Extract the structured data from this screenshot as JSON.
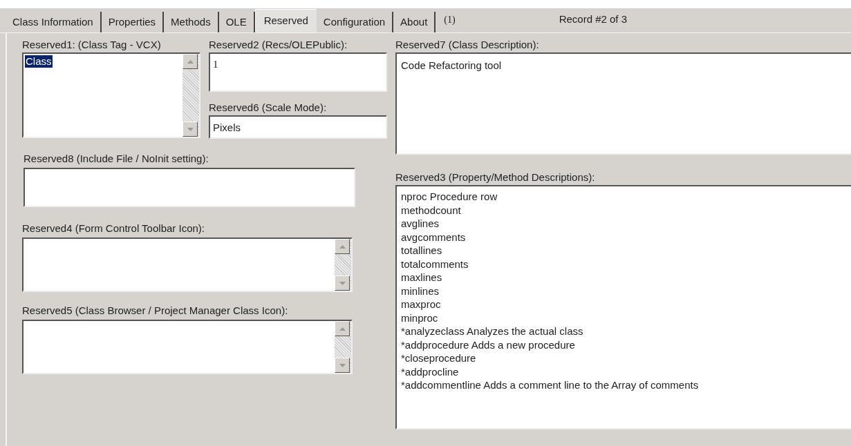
{
  "tabs": [
    {
      "label": "Class Information",
      "selected": false
    },
    {
      "label": "Properties",
      "selected": false
    },
    {
      "label": "Methods",
      "selected": false
    },
    {
      "label": "OLE",
      "selected": false
    },
    {
      "label": "Reserved",
      "selected": true
    },
    {
      "label": "Configuration",
      "selected": false
    },
    {
      "label": "About",
      "selected": false
    }
  ],
  "tab_note": "(1)",
  "record_indicator": "Record #2 of 3",
  "reserved1": {
    "label": "Reserved1: (Class Tag - VCX)",
    "items": [
      {
        "text": "Class",
        "selected": true
      }
    ]
  },
  "reserved2": {
    "label": "Reserved2 (Recs/OLEPublic):",
    "value": "1"
  },
  "reserved6": {
    "label": "Reserved6 (Scale Mode):",
    "value": "Pixels"
  },
  "reserved7": {
    "label": "Reserved7 (Class Description):",
    "value": "Code Refactoring tool"
  },
  "reserved8": {
    "label": "Reserved8 (Include File / NoInit setting):"
  },
  "reserved4": {
    "label": "Reserved4 (Form Control Toolbar Icon):"
  },
  "reserved5": {
    "label": "Reserved5 (Class Browser / Project Manager Class Icon):"
  },
  "reserved3": {
    "label": "Reserved3 (Property/Method Descriptions):",
    "lines": [
      "nproc Procedure row",
      "methodcount",
      "avglines",
      "avgcomments",
      "totallines",
      "totalcomments",
      "maxlines",
      "minlines",
      "maxproc",
      "minproc",
      "*analyzeclass Analyzes the actual class",
      "*addprocedure Adds a new procedure",
      "*closeprocedure",
      "*addprocline",
      "*addcommentline Adds a comment line to the Array of comments"
    ]
  }
}
